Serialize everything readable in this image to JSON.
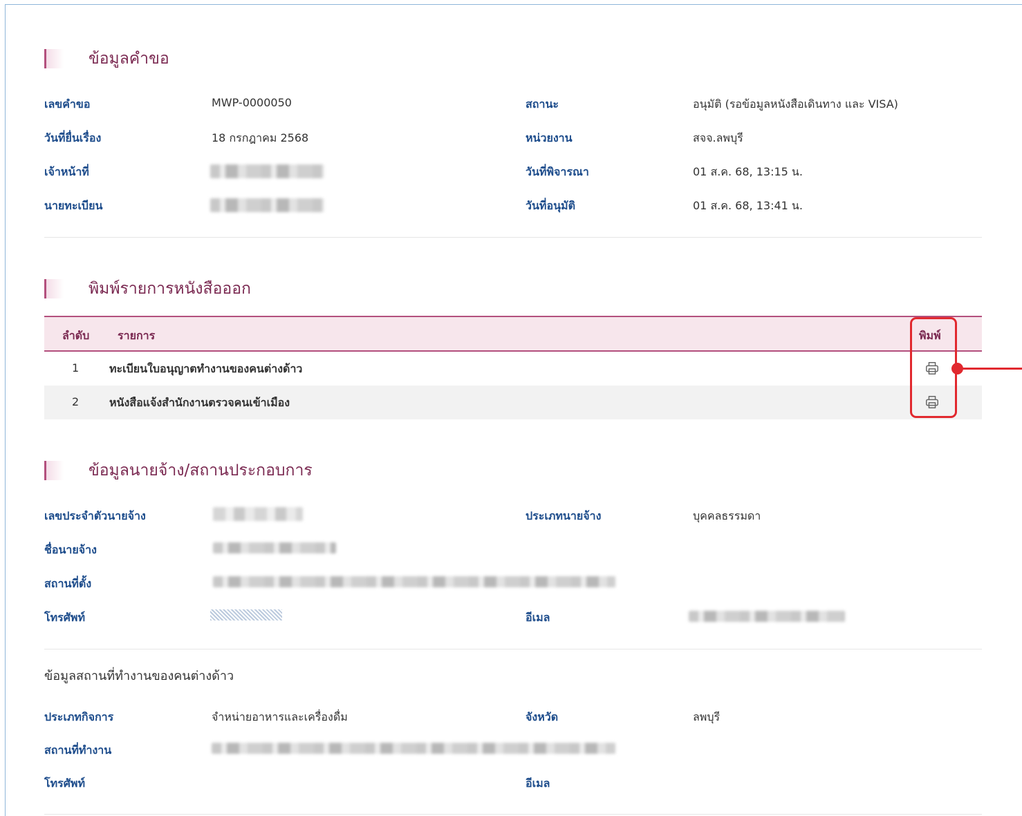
{
  "request_section": {
    "title": "ข้อมูลคำขอ",
    "fields": {
      "request_no_label": "เลขคำขอ",
      "request_no_value": "MWP-0000050",
      "status_label": "สถานะ",
      "status_value": "อนุมัติ (รอข้อมูลหนังสือเดินทาง และ VISA)",
      "submit_date_label": "วันที่ยื่นเรื่อง",
      "submit_date_value": "18 กรกฎาคม 2568",
      "agency_label": "หน่วยงาน",
      "agency_value": "สจจ.ลพบุรี",
      "officer_label": "เจ้าหน้าที่",
      "consider_date_label": "วันที่พิจารณา",
      "consider_date_value": "01 ส.ค. 68, 13:15 น.",
      "registrar_label": "นายทะเบียน",
      "approve_date_label": "วันที่อนุมัติ",
      "approve_date_value": "01 ส.ค. 68, 13:41 น."
    }
  },
  "print_section": {
    "title": "พิมพ์รายการหนังสือออก",
    "columns": {
      "index": "ลำดับ",
      "item": "รายการ",
      "print": "พิมพ์"
    },
    "rows": [
      {
        "index": "1",
        "item": "ทะเบียนใบอนุญาตทำงานของคนต่างด้าว",
        "icon": "printer-icon"
      },
      {
        "index": "2",
        "item": "หนังสือแจ้งสำนักงานตรวจคนเข้าเมือง",
        "icon": "printer-icon"
      }
    ],
    "highlight_color": "#e1292f"
  },
  "employer_section": {
    "title": "ข้อมูลนายจ้าง/สถานประกอบการ",
    "fields": {
      "employer_id_label": "เลขประจำตัวนายจ้าง",
      "employer_type_label": "ประเภทนายจ้าง",
      "employer_type_value": "บุคคลธรรมดา",
      "employer_name_label": "ชื่อนายจ้าง",
      "address_label": "สถานที่ตั้ง",
      "phone_label": "โทรศัพท์",
      "email_label": "อีเมล"
    }
  },
  "workplace_section": {
    "title": "ข้อมูลสถานที่ทำงานของคนต่างด้าว",
    "fields": {
      "business_type_label": "ประเภทกิจการ",
      "business_type_value": "จำหน่ายอาหารและเครื่องดื่ม",
      "province_label": "จังหวัด",
      "province_value": "ลพบุรี",
      "workplace_label": "สถานที่ทำงาน",
      "phone_label": "โทรศัพท์",
      "email_label": "อีเมล"
    }
  },
  "colors": {
    "title": "#7b2a52",
    "label": "#1e4d8c",
    "accent": "#b3507d",
    "table_header_bg": "#f7e6ec"
  }
}
